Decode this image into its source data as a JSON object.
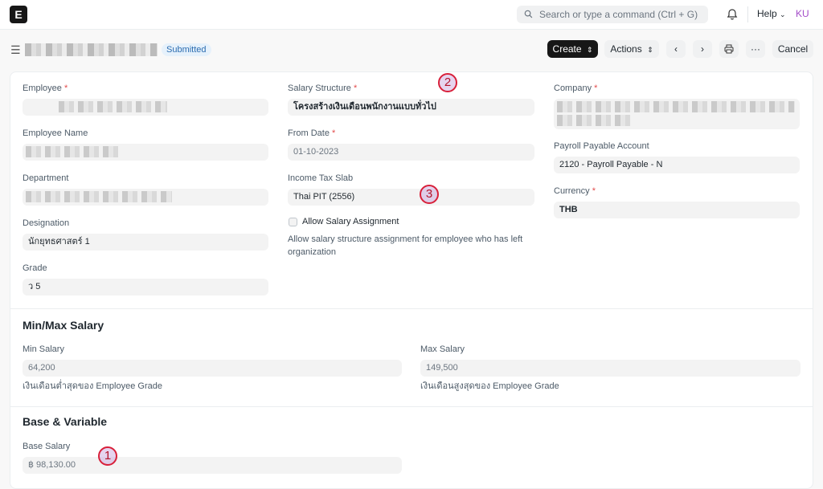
{
  "navbar": {
    "logo": "E",
    "search_placeholder": "Search or type a command (Ctrl + G)",
    "help_label": "Help",
    "avatar": "KU"
  },
  "header": {
    "status_badge": "Submitted",
    "create_label": "Create",
    "actions_label": "Actions",
    "cancel_label": "Cancel",
    "more_label": "···"
  },
  "form": {
    "employee": {
      "label": "Employee"
    },
    "employee_name": {
      "label": "Employee Name"
    },
    "department": {
      "label": "Department"
    },
    "designation": {
      "label": "Designation",
      "value": "นักยุทธศาสตร์ 1"
    },
    "grade": {
      "label": "Grade",
      "value": "ว 5"
    },
    "salary_structure": {
      "label": "Salary Structure",
      "value": "โครงสร้างเงินเดือนพนักงานแบบทั่วไป"
    },
    "from_date": {
      "label": "From Date",
      "value": "01-10-2023"
    },
    "income_tax_slab": {
      "label": "Income Tax Slab",
      "value": "Thai PIT (2556)"
    },
    "allow_salary_assignment": {
      "label": "Allow Salary Assignment",
      "description": "Allow salary structure assignment for employee who has left organization"
    },
    "company": {
      "label": "Company"
    },
    "payroll_payable_account": {
      "label": "Payroll Payable Account",
      "value": "2120 - Payroll Payable - N"
    },
    "currency": {
      "label": "Currency",
      "value": "THB"
    },
    "required_mark": "*"
  },
  "minmax": {
    "title": "Min/Max Salary",
    "min_label": "Min Salary",
    "min_value": "64,200",
    "min_hint": "เงินเดือนต่ำสุดของ Employee Grade",
    "max_label": "Max Salary",
    "max_value": "149,500",
    "max_hint": "เงินเดือนสูงสุดของ Employee Grade"
  },
  "base": {
    "title": "Base & Variable",
    "base_label": "Base Salary",
    "base_value": "฿ 98,130.00"
  },
  "annotations": {
    "m1": "1",
    "m2": "2",
    "m3": "3"
  }
}
